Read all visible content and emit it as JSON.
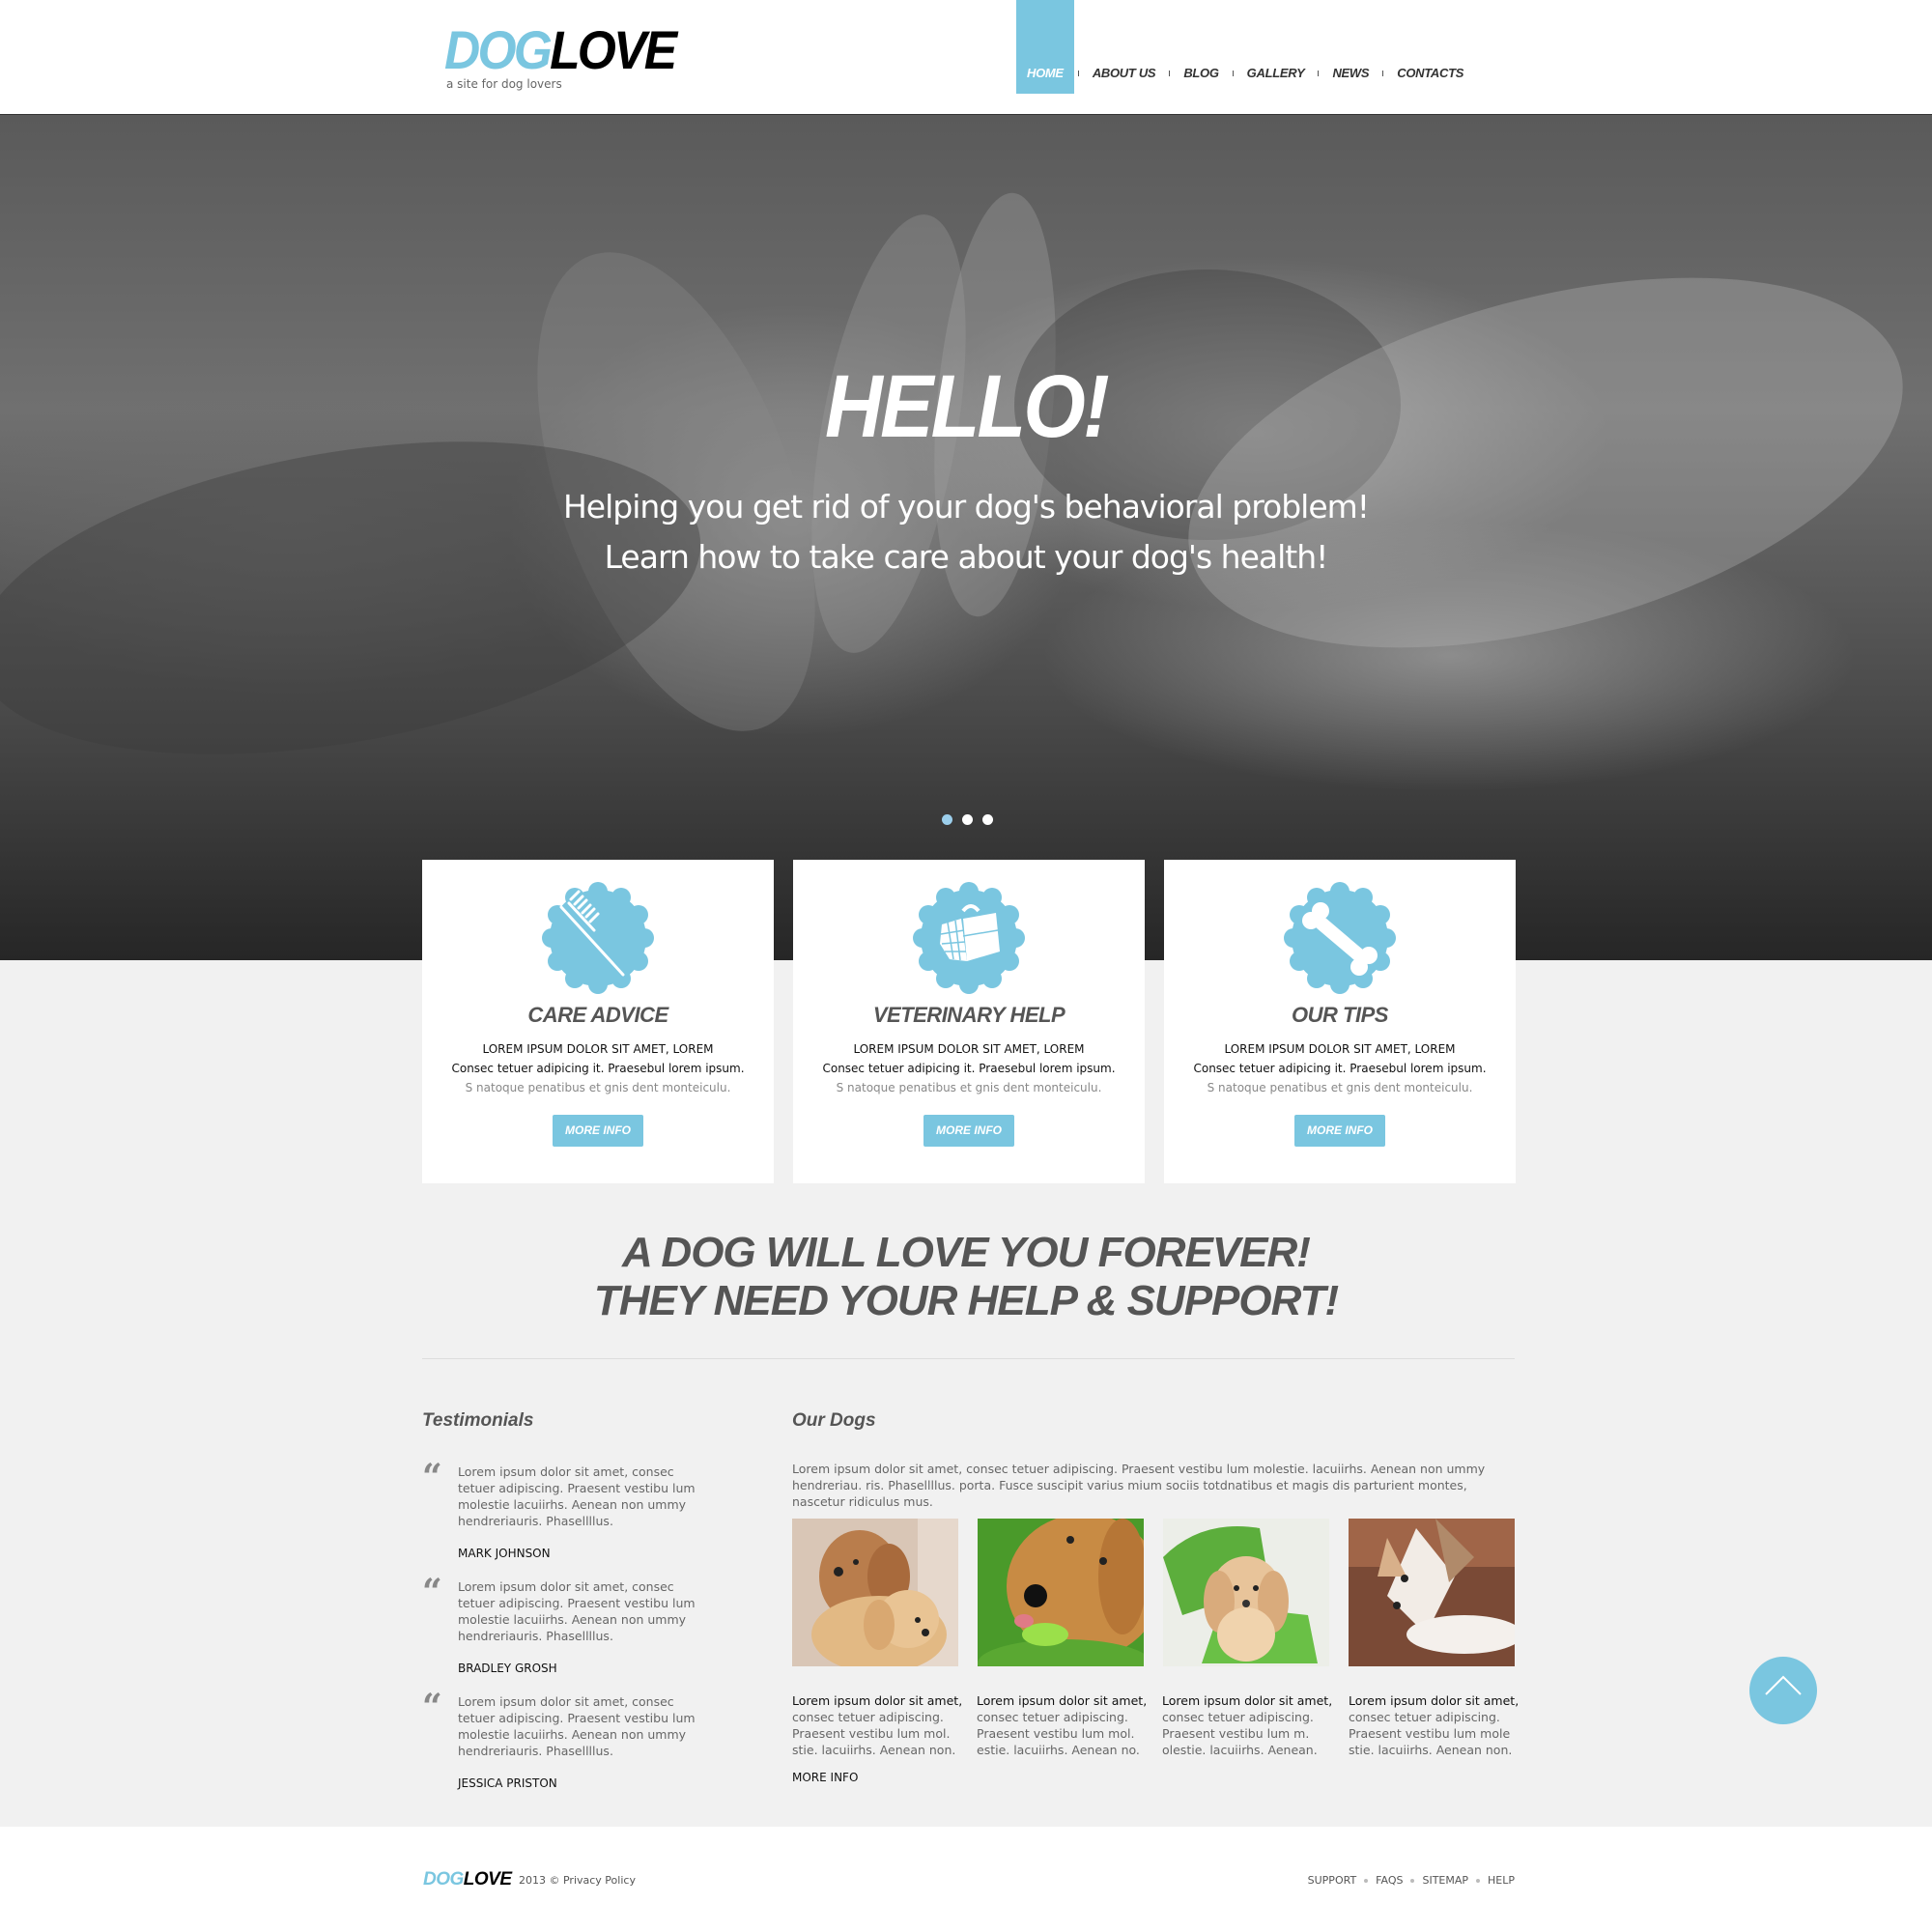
{
  "brand": {
    "logo_part1": "DOG",
    "logo_part2": "LOVE",
    "tagline": "a site for dog lovers",
    "accent_color": "#7ac6e0"
  },
  "nav": {
    "items": [
      {
        "label": "HOME",
        "active": true
      },
      {
        "label": "ABOUT US"
      },
      {
        "label": "BLOG"
      },
      {
        "label": "GALLERY"
      },
      {
        "label": "NEWS"
      },
      {
        "label": "CONTACTS"
      }
    ]
  },
  "hero": {
    "title": "HELLO!",
    "line1": "Helping you get rid of your dog's behavioral problem!",
    "line2": "Learn how to take care about your dog's health!",
    "slides": 3,
    "active_slide": 1
  },
  "features": [
    {
      "icon": "comb-icon",
      "title": "CARE ADVICE",
      "line1": "LOREM IPSUM DOLOR SIT AMET, LOREM",
      "line2": "Consec tetuer adipicing it. Praesebul lorem ipsum.",
      "line3": "S natoque penatibus et gnis dent monteiculu.",
      "button": "MORE INFO"
    },
    {
      "icon": "pet-carrier-icon",
      "title": "VETERINARY HELP",
      "line1": "LOREM IPSUM DOLOR SIT AMET, LOREM",
      "line2": "Consec tetuer adipicing it. Praesebul lorem ipsum.",
      "line3": "S natoque penatibus et gnis dent monteiculu.",
      "button": "MORE INFO"
    },
    {
      "icon": "bone-icon",
      "title": "OUR TIPS",
      "line1": "LOREM IPSUM DOLOR SIT AMET, LOREM",
      "line2": "Consec tetuer adipicing it. Praesebul lorem ipsum.",
      "line3": "S natoque penatibus et gnis dent monteiculu.",
      "button": "MORE INFO"
    }
  ],
  "slogan": {
    "line1": "A DOG WILL LOVE YOU FOREVER!",
    "line2": "THEY NEED YOUR HELP & SUPPORT!"
  },
  "testimonials": {
    "title": "Testimonials",
    "items": [
      {
        "text": "Lorem ipsum dolor sit amet, consec tetuer adipiscing. Praesent vestibu lum molestie lacuiirhs. Aenean non ummy hendreriauris. Phasellllus.",
        "name": "MARK JOHNSON"
      },
      {
        "text": "Lorem ipsum dolor sit amet, consec tetuer adipiscing. Praesent vestibu lum molestie lacuiirhs. Aenean non ummy hendreriauris. Phasellllus.",
        "name": "BRADLEY GROSH"
      },
      {
        "text": "Lorem ipsum dolor sit amet, consec tetuer adipiscing. Praesent vestibu lum molestie lacuiirhs. Aenean non ummy hendreriauris. Phasellllus.",
        "name": "JESSICA PRISTON"
      }
    ]
  },
  "dogs": {
    "title": "Our Dogs",
    "intro": "Lorem ipsum dolor sit amet, consec tetuer adipiscing. Praesent vestibu lum molestie. lacuiirhs. Aenean non ummy hendreriau. ris. Phasellllus. porta. Fusce suscipit varius mium sociis totdnatibus et magis dis parturient montes, nascetur ridiculus mus.",
    "items": [
      {
        "photo": "two-dachshund-puppies",
        "lead": "Lorem ipsum dolor sit amet,",
        "text": "consec tetuer adipiscing. Praesent vestibu lum mol. stie. lacuiirhs. Aenean non."
      },
      {
        "photo": "golden-retriever-with-toy",
        "lead": "Lorem ipsum dolor sit amet,",
        "text": "consec tetuer adipiscing. Praesent vestibu lum mol. estie. lacuiirhs. Aenean no."
      },
      {
        "photo": "cocker-spaniel-in-basket",
        "lead": "Lorem ipsum dolor sit amet,",
        "text": "consec tetuer adipiscing. Praesent vestibu lum m. olestie. lacuiirhs. Aenean."
      },
      {
        "photo": "dog-lying-on-floor",
        "lead": "Lorem ipsum dolor sit amet,",
        "text": "consec tetuer adipiscing. Praesent vestibu lum mole stie. lacuiirhs. Aenean non."
      }
    ],
    "more": "MORE INFO"
  },
  "footer": {
    "logo_part1": "DOG",
    "logo_part2": "LOVE",
    "copyright": "2013 © Privacy Policy",
    "links": [
      "SUPPORT",
      "FAQS",
      "SITEMAP",
      "HELP"
    ]
  }
}
